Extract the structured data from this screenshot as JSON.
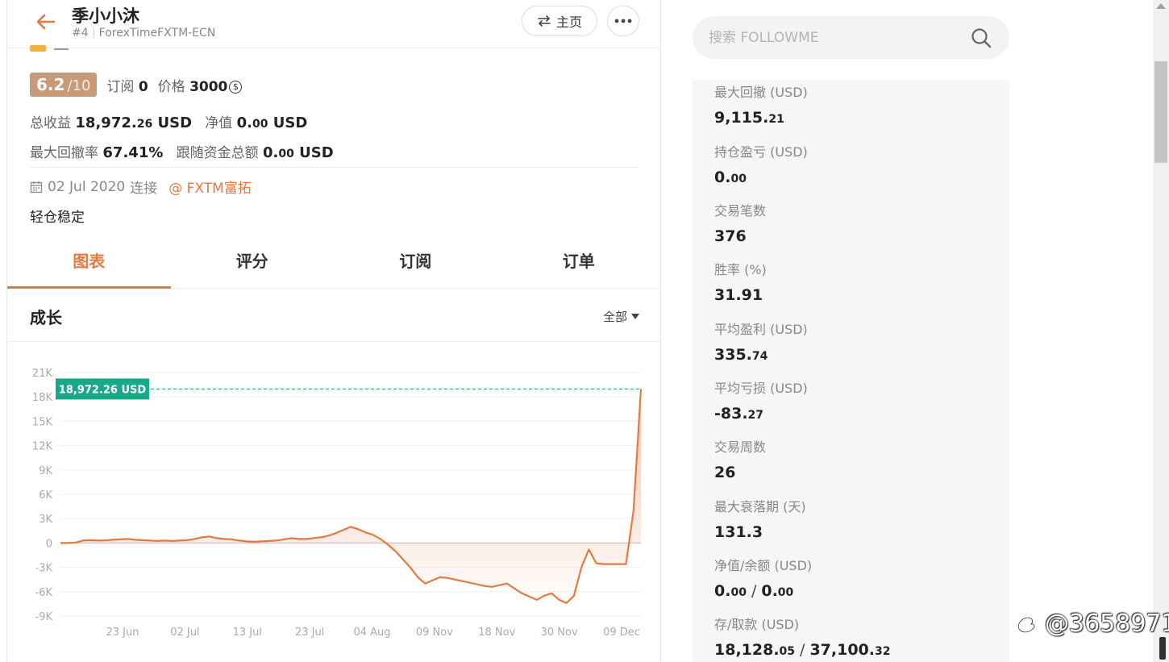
{
  "header": {
    "title": "季小小沐",
    "rank": "#4",
    "account": "ForexTimeFXTM-ECN",
    "home_label": "主页"
  },
  "summary": {
    "score": "6.2",
    "score_den": "/10",
    "subs_label": "订阅",
    "subs_value": "0",
    "price_label": "价格",
    "price_value": "3000",
    "coin_symbol": "$",
    "total_profit_label": "总收益",
    "total_profit_int": "18,972.",
    "total_profit_dec": "26",
    "total_profit_unit": "USD",
    "equity_label": "净值",
    "equity_int": "0.",
    "equity_dec": "00",
    "equity_unit": "USD",
    "max_dd_rate_label": "最大回撤率",
    "max_dd_rate_value": "67.41%",
    "follow_total_label": "跟随资金总额",
    "follow_total_int": "0.",
    "follow_total_dec": "00",
    "follow_total_unit": "USD",
    "connect_date": "02 Jul 2020",
    "connect_label": "连接",
    "broker": "@ FXTM富拓",
    "description": "轻仓稳定"
  },
  "tabs": [
    "图表",
    "评分",
    "订阅",
    "订单"
  ],
  "growth": {
    "title": "成长",
    "range_label": "全部"
  },
  "chart_data": {
    "type": "area",
    "x_tick_labels": [
      "23 Jun",
      "02 Jul",
      "13 Jul",
      "23 Jul",
      "04 Aug",
      "09 Nov",
      "18 Nov",
      "30 Nov",
      "09 Dec"
    ],
    "y_tick_labels": [
      "21K",
      "18K",
      "15K",
      "12K",
      "9K",
      "6K",
      "3K",
      "0",
      "-3K",
      "-6K",
      "-9K"
    ],
    "ylim": [
      -9000,
      21000
    ],
    "current_value": 18972.26,
    "current_label": "18,972.26 USD",
    "line_color": "#e6793f",
    "marker_color": "#1aa88a",
    "series": [
      {
        "values": [
          0,
          0,
          50,
          300,
          350,
          300,
          320,
          400,
          450,
          500,
          400,
          350,
          300,
          250,
          300,
          250,
          300,
          350,
          500,
          700,
          800,
          600,
          500,
          450,
          300,
          200,
          150,
          200,
          250,
          300,
          450,
          600,
          500,
          500,
          600,
          700,
          900,
          1200,
          1600,
          2000,
          1700,
          1300,
          1000,
          500,
          -200,
          -1000,
          -2000,
          -3000,
          -4200,
          -5000,
          -4600,
          -4200,
          -4300,
          -4500,
          -4700,
          -4900,
          -5100,
          -5300,
          -5400,
          -5200,
          -5000,
          -5600,
          -6200,
          -6600,
          -7000,
          -6500,
          -6200,
          -7000,
          -7400,
          -6500,
          -3000,
          -800,
          -2500,
          -2600,
          -2600,
          -2600,
          -2600,
          4000,
          18972.26
        ]
      }
    ]
  },
  "search": {
    "placeholder": "搜索 FOLLOWME"
  },
  "stats": [
    {
      "label": "最大回撤 (USD)",
      "int": "9,115.",
      "dec": "21"
    },
    {
      "label": "持仓盈亏 (USD)",
      "int": "0.",
      "dec": "00"
    },
    {
      "label": "交易笔数",
      "int": "376",
      "dec": ""
    },
    {
      "label": "胜率 (%)",
      "int": "31.91",
      "dec": ""
    },
    {
      "label": "平均盈利 (USD)",
      "int": "335.",
      "dec": "74"
    },
    {
      "label": "平均亏损 (USD)",
      "int": "-83.",
      "dec": "27"
    },
    {
      "label": "交易周数",
      "int": "26",
      "dec": ""
    },
    {
      "label": "最大衰落期 (天)",
      "int": "131.3",
      "dec": ""
    }
  ],
  "stats_pairs": [
    {
      "label": "净值/余额 (USD)",
      "a_int": "0.",
      "a_dec": "00",
      "b_int": "0.",
      "b_dec": "00"
    },
    {
      "label": "存/取款 (USD)",
      "a_int": "18,128.",
      "a_dec": "05",
      "b_int": "37,100.",
      "b_dec": "32"
    }
  ],
  "watermark": "@3658971"
}
